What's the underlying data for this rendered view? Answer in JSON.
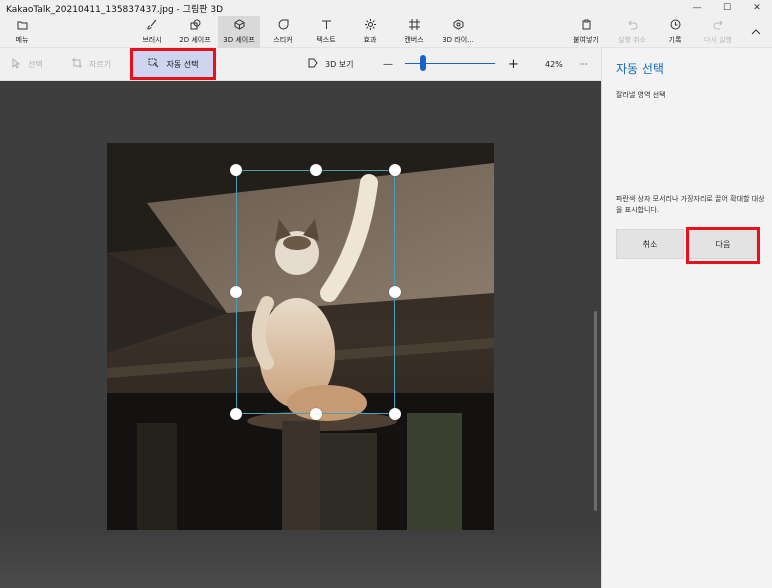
{
  "window": {
    "title": "KakaoTalk_20210411_135837437.jpg - 그림판 3D",
    "minimize": "—",
    "maximize": "☐",
    "close": "✕"
  },
  "ribbon": {
    "menu": "메뉴",
    "tools": [
      {
        "label": "브러시",
        "icon": "brush-icon"
      },
      {
        "label": "2D 셰이프",
        "icon": "2d-shapes-icon"
      },
      {
        "label": "3D 셰이프",
        "icon": "3d-shapes-icon"
      },
      {
        "label": "스티커",
        "icon": "sticker-icon"
      },
      {
        "label": "텍스트",
        "icon": "text-icon"
      },
      {
        "label": "효과",
        "icon": "effects-icon"
      },
      {
        "label": "캔버스",
        "icon": "canvas-icon"
      },
      {
        "label": "3D 라이...",
        "icon": "3d-library-icon"
      }
    ],
    "right": [
      {
        "label": "붙여넣기",
        "icon": "paste-icon"
      },
      {
        "label": "실행 취소",
        "icon": "undo-icon"
      },
      {
        "label": "기록",
        "icon": "history-icon"
      },
      {
        "label": "다시 실행",
        "icon": "redo-icon"
      }
    ]
  },
  "subbar": {
    "select": "선택",
    "crop": "자르기",
    "auto_select": "자동 선택",
    "view_3d": "3D 보기",
    "zoom_minus": "—",
    "zoom_plus": "+",
    "zoom": "42%",
    "more": "···",
    "zoom_fraction": 0.2
  },
  "panel": {
    "title": "자동 선택",
    "subtitle": "잘라낼 영역 선택",
    "description": "파란색 상자 모서리나 가장자리로 끌어 확대할 대상을 표시합니다.",
    "cancel": "취소",
    "next": "다음"
  },
  "colors": {
    "accent": "#1567c0",
    "highlight": "#e8101a",
    "canvas": "#3e3e3e",
    "selection_border": "#4aa0b8"
  }
}
